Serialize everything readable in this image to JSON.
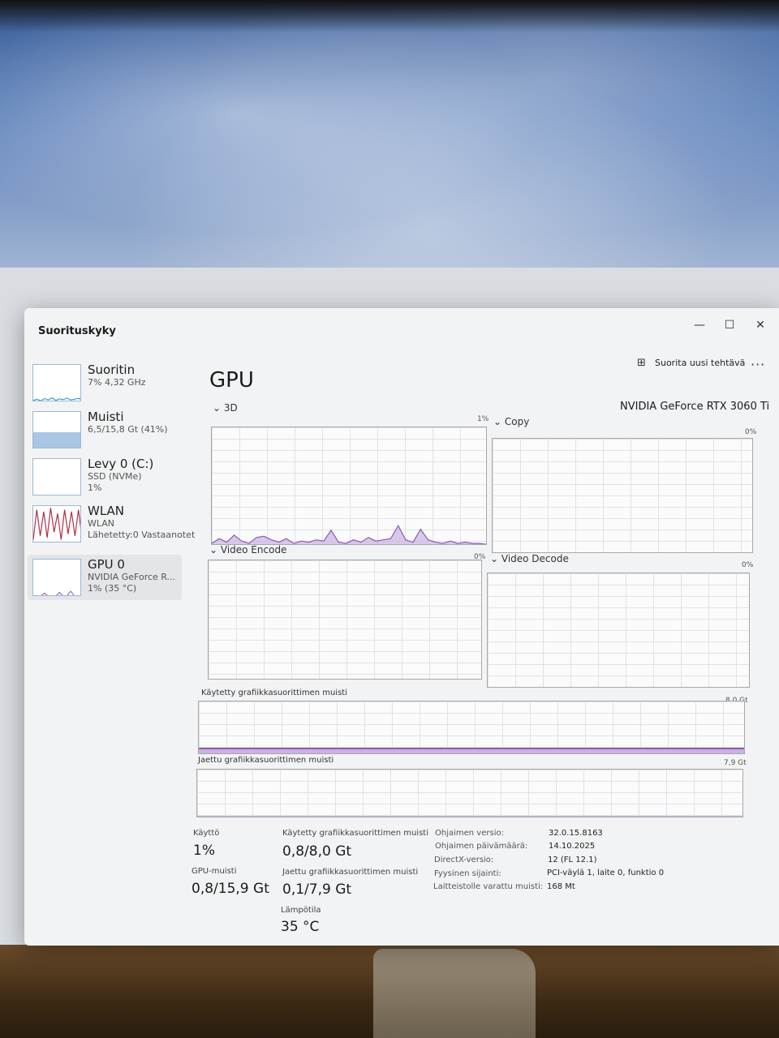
{
  "window": {
    "title": "Suorituskyky",
    "controls": {
      "minimize": "—",
      "maximize": "☐",
      "close": "✕"
    }
  },
  "sidebar": {
    "items": [
      {
        "title": "Suoritin",
        "line1": "7% 4,32 GHz",
        "line2": ""
      },
      {
        "title": "Muisti",
        "line1": "6,5/15,8 Gt (41%)",
        "line2": ""
      },
      {
        "title": "Levy 0 (C:)",
        "line1": "SSD (NVMe)",
        "line2": "1%"
      },
      {
        "title": "WLAN",
        "line1": "WLAN",
        "line2": "Lähetetty:0 Vastaanotet"
      },
      {
        "title": "GPU 0",
        "line1": "NVIDIA GeForce R...",
        "line2": "1% (35 °C)"
      }
    ],
    "selected_index": 4
  },
  "toolbar": {
    "run_task_label": "Suorita uusi tehtävä",
    "run_task_icon": "run-task-icon",
    "more_icon": "more-options-icon"
  },
  "main": {
    "heading": "GPU",
    "adapter_name": "NVIDIA GeForce RTX 3060 Ti",
    "engines": [
      {
        "label": "3D",
        "percent": "1%",
        "utilization": 0.01
      },
      {
        "label": "Copy",
        "percent": "0%",
        "utilization": 0.0
      },
      {
        "label": "Video Encode",
        "percent": "0%",
        "utilization": 0.0
      },
      {
        "label": "Video Decode",
        "percent": "0%",
        "utilization": 0.0
      }
    ],
    "dedicated_memory": {
      "label": "Käytetty grafiikkasuorittimen muisti",
      "max": "8,0 Gt"
    },
    "shared_memory": {
      "label": "Jaettu grafiikkasuorittimen muisti",
      "max": "7,9 Gt"
    }
  },
  "stats": {
    "utilization": {
      "label": "Käyttö",
      "value": "1%"
    },
    "dedicated_used": {
      "label": "Käytetty grafiikkasuorittimen muisti",
      "value": "0,8/8,0 Gt"
    },
    "gpu_memory": {
      "label": "GPU-muisti",
      "value": "0,8/15,9 Gt"
    },
    "shared_used": {
      "label": "Jaettu grafiikkasuorittimen muisti",
      "value": "0,1/7,9 Gt"
    },
    "temperature": {
      "label": "Lämpötila",
      "value": "35 °C"
    }
  },
  "details": [
    {
      "label": "Ohjaimen versio:",
      "value": "32.0.15.8163"
    },
    {
      "label": "Ohjaimen päivämäärä:",
      "value": "14.10.2025"
    },
    {
      "label": "DirectX-versio:",
      "value": "12 (FL 12.1)"
    },
    {
      "label": "Fyysinen sijainti:",
      "value": "PCI-väylä 1, laite 0, funktio 0"
    },
    {
      "label": "Laitteistolle varattu muisti:",
      "value": "168 Mt"
    }
  ],
  "colors": {
    "gpu_line": "#8e5ab5",
    "gpu_fill": "#c9b3e0",
    "cpu_line": "#2a8cbf",
    "memory_fill": "#a9c6e4",
    "wlan_line": "#b0304a"
  }
}
